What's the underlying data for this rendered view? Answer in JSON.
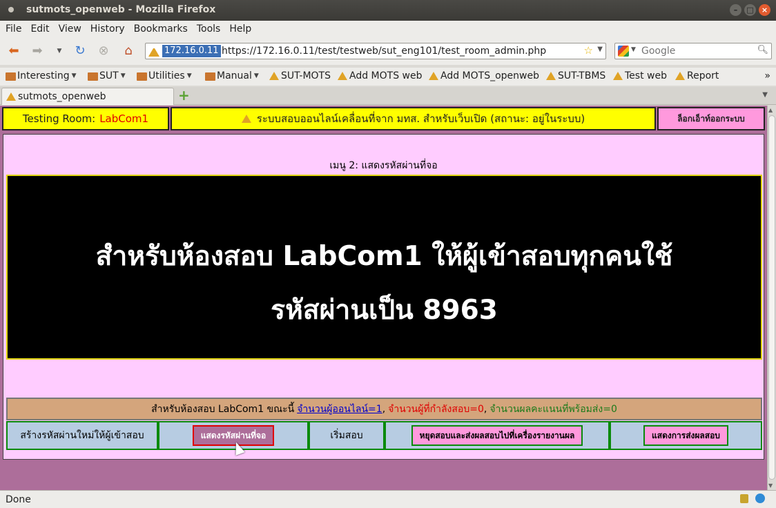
{
  "window": {
    "title": "sutmots_openweb - Mozilla Firefox"
  },
  "menubar": {
    "items": [
      "File",
      "Edit",
      "View",
      "History",
      "Bookmarks",
      "Tools",
      "Help"
    ]
  },
  "navbar": {
    "ip_badge": "172.16.0.11",
    "url": "https://172.16.0.11/test/testweb/sut_eng101/test_room_admin.php",
    "search_placeholder": "Google"
  },
  "bookmarks": {
    "items": [
      {
        "label": "Interesting",
        "kind": "folder"
      },
      {
        "label": "SUT",
        "kind": "folder"
      },
      {
        "label": "Utilities",
        "kind": "folder"
      },
      {
        "label": "Manual",
        "kind": "folder"
      },
      {
        "label": "SUT-MOTS",
        "kind": "link"
      },
      {
        "label": "Add MOTS web",
        "kind": "link"
      },
      {
        "label": "Add MOTS_openweb",
        "kind": "link"
      },
      {
        "label": "SUT-TBMS",
        "kind": "link"
      },
      {
        "label": "Test web",
        "kind": "link"
      },
      {
        "label": "Report",
        "kind": "link"
      }
    ],
    "overflow": "»"
  },
  "tabs": [
    {
      "label": "sutmots_openweb"
    }
  ],
  "page": {
    "room_label": "Testing  Room:",
    "room_name": "LabCom1",
    "system_title": "ระบบสอบออนไลน์เคลื่อนที่จาก มทส. สำหรับเว็บเปิด (สถานะ: อยู่ในระบบ)",
    "logout_label": "ล็อกเอ็าท์ออกระบบ",
    "menu_caption": "เมนู 2: แสดงรหัสผ่านที่จอ",
    "big_line1": "สำหรับห้องสอบ LabCom1 ให้ผู้เข้าสอบทุกคนใช้",
    "big_line2": "รหัสผ่านเป็น 8963",
    "status_prefix": "สำหรับห้องสอบ  LabCom1  ขณะนี้",
    "status_online": "จำนวนผู้ออนไลน์=1",
    "status_testing": "จำนวนผู้ที่กำลังสอบ=0",
    "status_ready": "จำนวนผลคะแนนที่พร้อมส่ง=0",
    "sep": ",",
    "actions": {
      "create_password": "สร้างรหัสผ่านใหม่ให้ผู้เข้าสอบ",
      "show_password": "แสดงรหัสผ่านที่จอ",
      "start_exam": "เริ่มสอบ",
      "stop_exam": "หยุดสอบและส่งผลสอบไปที่เครื่องรายงานผล",
      "show_sending": "แสดงการส่งผลสอบ"
    }
  },
  "statusbar": {
    "text": "Done"
  },
  "colors": {
    "yellow": "#ffff00",
    "pink": "#ffccff",
    "page_bg": "#ad6e9a",
    "tan": "#d4a57c",
    "blue_cell": "#b7cce2"
  }
}
